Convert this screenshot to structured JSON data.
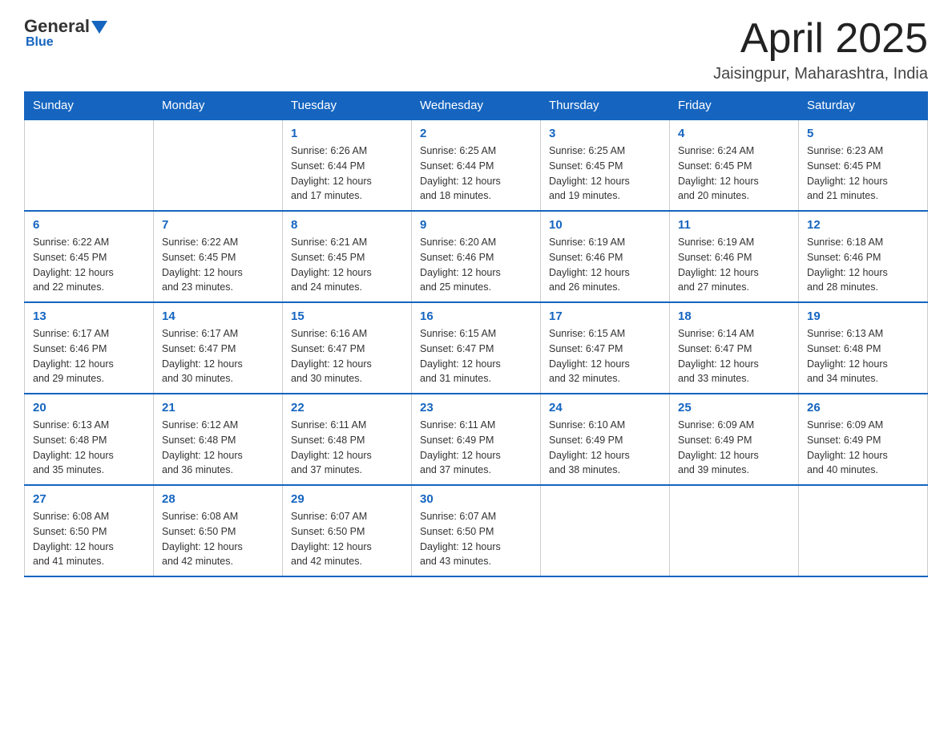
{
  "logo": {
    "general": "General",
    "blue": "Blue"
  },
  "header": {
    "month_year": "April 2025",
    "location": "Jaisingpur, Maharashtra, India"
  },
  "days_of_week": [
    "Sunday",
    "Monday",
    "Tuesday",
    "Wednesday",
    "Thursday",
    "Friday",
    "Saturday"
  ],
  "weeks": [
    [
      {
        "day": "",
        "info": ""
      },
      {
        "day": "",
        "info": ""
      },
      {
        "day": "1",
        "info": "Sunrise: 6:26 AM\nSunset: 6:44 PM\nDaylight: 12 hours\nand 17 minutes."
      },
      {
        "day": "2",
        "info": "Sunrise: 6:25 AM\nSunset: 6:44 PM\nDaylight: 12 hours\nand 18 minutes."
      },
      {
        "day": "3",
        "info": "Sunrise: 6:25 AM\nSunset: 6:45 PM\nDaylight: 12 hours\nand 19 minutes."
      },
      {
        "day": "4",
        "info": "Sunrise: 6:24 AM\nSunset: 6:45 PM\nDaylight: 12 hours\nand 20 minutes."
      },
      {
        "day": "5",
        "info": "Sunrise: 6:23 AM\nSunset: 6:45 PM\nDaylight: 12 hours\nand 21 minutes."
      }
    ],
    [
      {
        "day": "6",
        "info": "Sunrise: 6:22 AM\nSunset: 6:45 PM\nDaylight: 12 hours\nand 22 minutes."
      },
      {
        "day": "7",
        "info": "Sunrise: 6:22 AM\nSunset: 6:45 PM\nDaylight: 12 hours\nand 23 minutes."
      },
      {
        "day": "8",
        "info": "Sunrise: 6:21 AM\nSunset: 6:45 PM\nDaylight: 12 hours\nand 24 minutes."
      },
      {
        "day": "9",
        "info": "Sunrise: 6:20 AM\nSunset: 6:46 PM\nDaylight: 12 hours\nand 25 minutes."
      },
      {
        "day": "10",
        "info": "Sunrise: 6:19 AM\nSunset: 6:46 PM\nDaylight: 12 hours\nand 26 minutes."
      },
      {
        "day": "11",
        "info": "Sunrise: 6:19 AM\nSunset: 6:46 PM\nDaylight: 12 hours\nand 27 minutes."
      },
      {
        "day": "12",
        "info": "Sunrise: 6:18 AM\nSunset: 6:46 PM\nDaylight: 12 hours\nand 28 minutes."
      }
    ],
    [
      {
        "day": "13",
        "info": "Sunrise: 6:17 AM\nSunset: 6:46 PM\nDaylight: 12 hours\nand 29 minutes."
      },
      {
        "day": "14",
        "info": "Sunrise: 6:17 AM\nSunset: 6:47 PM\nDaylight: 12 hours\nand 30 minutes."
      },
      {
        "day": "15",
        "info": "Sunrise: 6:16 AM\nSunset: 6:47 PM\nDaylight: 12 hours\nand 30 minutes."
      },
      {
        "day": "16",
        "info": "Sunrise: 6:15 AM\nSunset: 6:47 PM\nDaylight: 12 hours\nand 31 minutes."
      },
      {
        "day": "17",
        "info": "Sunrise: 6:15 AM\nSunset: 6:47 PM\nDaylight: 12 hours\nand 32 minutes."
      },
      {
        "day": "18",
        "info": "Sunrise: 6:14 AM\nSunset: 6:47 PM\nDaylight: 12 hours\nand 33 minutes."
      },
      {
        "day": "19",
        "info": "Sunrise: 6:13 AM\nSunset: 6:48 PM\nDaylight: 12 hours\nand 34 minutes."
      }
    ],
    [
      {
        "day": "20",
        "info": "Sunrise: 6:13 AM\nSunset: 6:48 PM\nDaylight: 12 hours\nand 35 minutes."
      },
      {
        "day": "21",
        "info": "Sunrise: 6:12 AM\nSunset: 6:48 PM\nDaylight: 12 hours\nand 36 minutes."
      },
      {
        "day": "22",
        "info": "Sunrise: 6:11 AM\nSunset: 6:48 PM\nDaylight: 12 hours\nand 37 minutes."
      },
      {
        "day": "23",
        "info": "Sunrise: 6:11 AM\nSunset: 6:49 PM\nDaylight: 12 hours\nand 37 minutes."
      },
      {
        "day": "24",
        "info": "Sunrise: 6:10 AM\nSunset: 6:49 PM\nDaylight: 12 hours\nand 38 minutes."
      },
      {
        "day": "25",
        "info": "Sunrise: 6:09 AM\nSunset: 6:49 PM\nDaylight: 12 hours\nand 39 minutes."
      },
      {
        "day": "26",
        "info": "Sunrise: 6:09 AM\nSunset: 6:49 PM\nDaylight: 12 hours\nand 40 minutes."
      }
    ],
    [
      {
        "day": "27",
        "info": "Sunrise: 6:08 AM\nSunset: 6:50 PM\nDaylight: 12 hours\nand 41 minutes."
      },
      {
        "day": "28",
        "info": "Sunrise: 6:08 AM\nSunset: 6:50 PM\nDaylight: 12 hours\nand 42 minutes."
      },
      {
        "day": "29",
        "info": "Sunrise: 6:07 AM\nSunset: 6:50 PM\nDaylight: 12 hours\nand 42 minutes."
      },
      {
        "day": "30",
        "info": "Sunrise: 6:07 AM\nSunset: 6:50 PM\nDaylight: 12 hours\nand 43 minutes."
      },
      {
        "day": "",
        "info": ""
      },
      {
        "day": "",
        "info": ""
      },
      {
        "day": "",
        "info": ""
      }
    ]
  ]
}
